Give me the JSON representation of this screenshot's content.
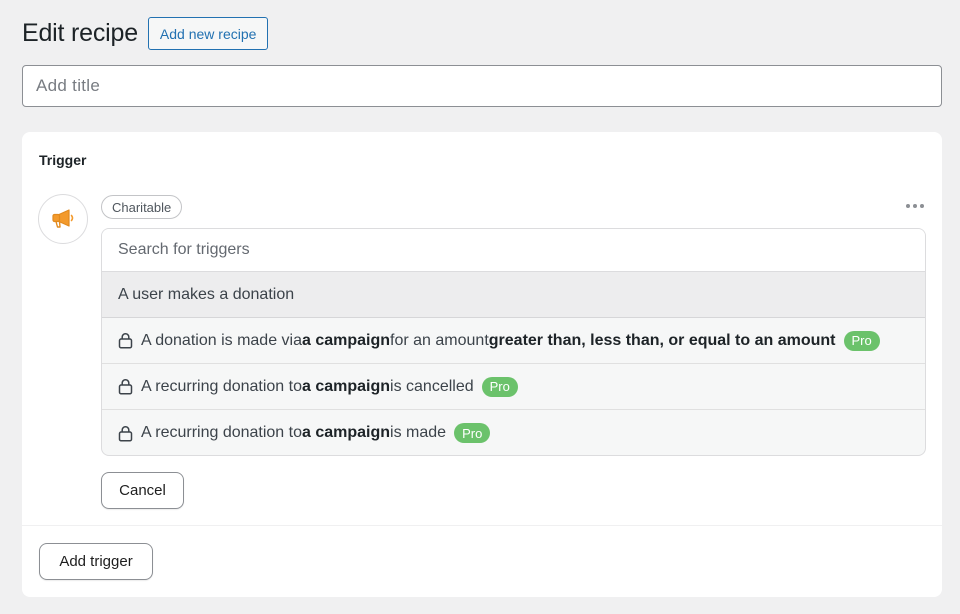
{
  "header": {
    "title": "Edit recipe",
    "add_new_label": "Add new recipe"
  },
  "title_input": {
    "placeholder": "Add title",
    "value": ""
  },
  "trigger_card": {
    "title": "Trigger",
    "integration": {
      "name": "Charitable",
      "icon": "megaphone-icon",
      "icon_color": "#f39a2c"
    },
    "more_icon": "ellipsis-icon",
    "search": {
      "placeholder": "Search for triggers",
      "value": ""
    },
    "options": [
      {
        "locked": false,
        "parts": [
          "A user makes a donation"
        ]
      },
      {
        "locked": true,
        "parts": [
          "A donation is made via ",
          "a campaign",
          " for an amount ",
          "greater than, less than, or equal to an amount"
        ],
        "badge": "Pro"
      },
      {
        "locked": true,
        "parts": [
          "A recurring donation to ",
          "a campaign",
          " is cancelled"
        ],
        "badge": "Pro"
      },
      {
        "locked": true,
        "parts": [
          "A recurring donation to ",
          "a campaign",
          " is made"
        ],
        "badge": "Pro"
      }
    ],
    "cancel_label": "Cancel",
    "add_trigger_label": "Add trigger"
  },
  "colors": {
    "accent": "#2271b1",
    "pro_badge": "#6bc26b",
    "page_background": "#f0f0f1"
  }
}
